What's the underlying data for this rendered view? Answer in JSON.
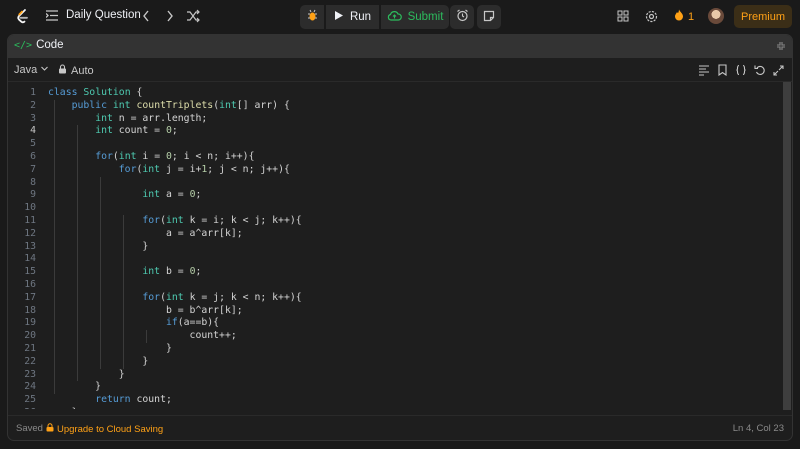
{
  "topbar": {
    "problem_list_label": "Daily Question",
    "run_label": "Run",
    "submit_label": "Submit",
    "streak_count": "1",
    "premium_label": "Premium"
  },
  "panel": {
    "title": "Code",
    "language": "Java",
    "mode": "Auto"
  },
  "editor": {
    "current_line": 4,
    "lines": [
      "class Solution {",
      "    public int countTriplets(int[] arr) {",
      "        int n = arr.length;",
      "        int count = 0;",
      "",
      "        for(int i = 0; i < n; i++){",
      "            for(int j = i+1; j < n; j++){",
      "",
      "                int a = 0;",
      "",
      "                for(int k = i; k < j; k++){",
      "                    a = a^arr[k];",
      "                }",
      "",
      "                int b = 0;",
      "",
      "                for(int k = j; k < n; k++){",
      "                    b = b^arr[k];",
      "                    if(a==b){",
      "                        count++;",
      "                    }",
      "                }",
      "            }",
      "        }",
      "        return count;",
      "    }"
    ]
  },
  "status": {
    "saved": "Saved",
    "upgrade": "Upgrade to Cloud Saving",
    "cursor": "Ln 4, Col 23"
  },
  "colors": {
    "accent_orange": "#ffa116",
    "submit_green": "#2cbb5d",
    "panel_bg": "#1e1e1e"
  }
}
